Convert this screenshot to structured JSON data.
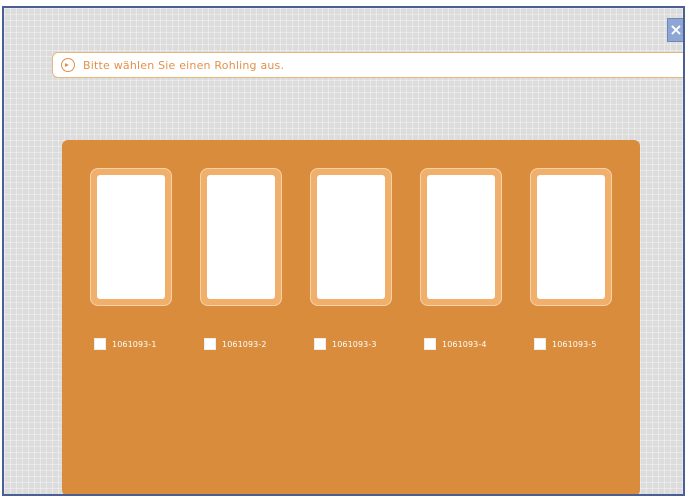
{
  "dialog": {
    "close_label": "×",
    "instruction": "Bitte wählen Sie einen Rohling aus."
  },
  "blanks": [
    {
      "id": "1061093-1"
    },
    {
      "id": "1061093-2"
    },
    {
      "id": "1061093-3"
    },
    {
      "id": "1061093-4"
    },
    {
      "id": "1061093-5"
    }
  ],
  "colors": {
    "panel": "#d98c3c",
    "accent": "#e0924a",
    "frame": "#4a5f95"
  }
}
